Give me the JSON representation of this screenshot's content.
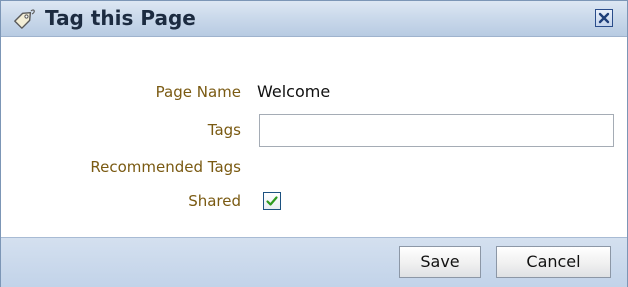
{
  "dialog": {
    "title": "Tag this Page",
    "title_icon": "tag-icon",
    "close_icon": "close-icon"
  },
  "form": {
    "page_name_label": "Page Name",
    "page_name_value": "Welcome",
    "tags_label": "Tags",
    "tags_value": "",
    "recommended_tags_label": "Recommended Tags",
    "shared_label": "Shared",
    "shared_checked": true
  },
  "footer": {
    "save_label": "Save",
    "cancel_label": "Cancel"
  },
  "colors": {
    "label_text": "#7a5a12",
    "titlebar": "#c9d8ea",
    "footer": "#c2d3e9",
    "checkmark": "#2e9a1f"
  }
}
